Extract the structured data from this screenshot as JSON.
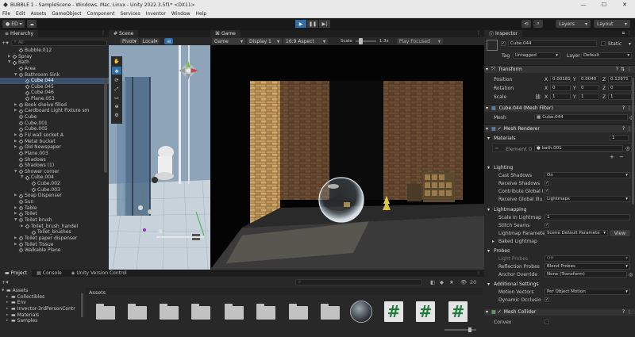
{
  "window": {
    "title": "BUBBLE 1 - SampleScene - Windows, Mac, Linux - Unity 2022.3.5f1* <DX11>",
    "controls": [
      "—",
      "☐",
      "✕"
    ]
  },
  "menu": [
    "File",
    "Edit",
    "Assets",
    "GameObject",
    "Component",
    "Services",
    "Inventor",
    "Window",
    "Help"
  ],
  "toolbar": {
    "account": "ED",
    "layers": "Layers",
    "layout": "Layout"
  },
  "hierarchy": {
    "tab": "Hierarchy",
    "search_placeholder": "All",
    "items": [
      {
        "label": "Bubble.012",
        "indent": 2,
        "arrow": false
      },
      {
        "label": "Spray",
        "indent": 1,
        "arrow": true
      },
      {
        "label": "Bath",
        "indent": 1,
        "arrow": true,
        "open": true
      },
      {
        "label": "Area",
        "indent": 2,
        "arrow": false
      },
      {
        "label": "Bathroom Sink",
        "indent": 2,
        "arrow": true,
        "open": true
      },
      {
        "label": "Cube.044",
        "indent": 3,
        "arrow": false,
        "selected": true
      },
      {
        "label": "Cube.045",
        "indent": 3,
        "arrow": false
      },
      {
        "label": "Cube.046",
        "indent": 3,
        "arrow": false
      },
      {
        "label": "Plane.053",
        "indent": 3,
        "arrow": false
      },
      {
        "label": "Book shelve filled",
        "indent": 2,
        "arrow": true
      },
      {
        "label": "Cardboard Light Fixture sm",
        "indent": 2,
        "arrow": true
      },
      {
        "label": "Cube",
        "indent": 2,
        "arrow": false
      },
      {
        "label": "Cube.001",
        "indent": 2,
        "arrow": false
      },
      {
        "label": "Cube.005",
        "indent": 2,
        "arrow": false
      },
      {
        "label": "FU wall socket A",
        "indent": 2,
        "arrow": true
      },
      {
        "label": "Metal bucket",
        "indent": 2,
        "arrow": true
      },
      {
        "label": "Old Newspaper",
        "indent": 2,
        "arrow": true
      },
      {
        "label": "Plane.003",
        "indent": 2,
        "arrow": false
      },
      {
        "label": "Shadows",
        "indent": 2,
        "arrow": false
      },
      {
        "label": "Shadows (1)",
        "indent": 2,
        "arrow": false
      },
      {
        "label": "Shower corner",
        "indent": 2,
        "arrow": true,
        "open": true
      },
      {
        "label": "Cube.004",
        "indent": 3,
        "arrow": true,
        "open": true
      },
      {
        "label": "Cube.002",
        "indent": 4,
        "arrow": false
      },
      {
        "label": "Cube.003",
        "indent": 4,
        "arrow": false
      },
      {
        "label": "Soap Dispenser",
        "indent": 2,
        "arrow": true
      },
      {
        "label": "Sun",
        "indent": 2,
        "arrow": false
      },
      {
        "label": "Table",
        "indent": 2,
        "arrow": true
      },
      {
        "label": "Toilet",
        "indent": 2,
        "arrow": true
      },
      {
        "label": "Toilet brush",
        "indent": 2,
        "arrow": true,
        "open": true
      },
      {
        "label": "Toilet_brush_handel",
        "indent": 3,
        "arrow": true
      },
      {
        "label": "Toilet_brushes",
        "indent": 4,
        "arrow": false
      },
      {
        "label": "Toilet paper dispenser",
        "indent": 2,
        "arrow": true
      },
      {
        "label": "Toilet Tissue",
        "indent": 2,
        "arrow": true
      },
      {
        "label": "Walkable Plane",
        "indent": 2,
        "arrow": false
      }
    ]
  },
  "scene": {
    "tab": "Scene",
    "pivot": "Pivot",
    "space": "Local"
  },
  "game": {
    "tab": "Game",
    "mode": "Game",
    "display": "Display 1",
    "aspect": "16:9 Aspect",
    "scale_label": "Scale",
    "scale_value": "1.3x",
    "play_focused": "Play Focused"
  },
  "inspector": {
    "tab": "Inspector",
    "object_name": "Cube.044",
    "static_label": "Static",
    "tag_label": "Tag",
    "tag_value": "Untagged",
    "layer_label": "Layer",
    "layer_value": "Default",
    "transform": {
      "title": "Transform",
      "position_label": "Position",
      "rotation_label": "Rotation",
      "scale_label": "Scale",
      "position": {
        "x": "0.00181",
        "y": "0.0040",
        "z": "0.12971"
      },
      "rotation": {
        "x": "0",
        "y": "0",
        "z": "0"
      },
      "scale": {
        "x": "1",
        "y": "1",
        "z": "1"
      }
    },
    "mesh_filter": {
      "title": "Cube.044 (Mesh Filter)",
      "mesh_label": "Mesh",
      "mesh_value": "Cube.044"
    },
    "mesh_renderer": {
      "title": "Mesh Renderer",
      "materials_label": "Materials",
      "materials_count": "1",
      "element_label": "Element 0",
      "element_value": "bath.001",
      "lighting_label": "Lighting",
      "cast_shadows_label": "Cast Shadows",
      "cast_shadows_value": "On",
      "receive_shadows_label": "Receive Shadows",
      "contribute_gi_label": "Contribute Global I",
      "receive_gi_label": "Receive Global Illu",
      "receive_gi_value": "Lightmaps",
      "lightmapping_label": "Lightmapping",
      "scale_lightmap_label": "Scale In Lightmap",
      "scale_lightmap_value": "1",
      "stitch_seams_label": "Stitch Seams",
      "lightmap_params_label": "Lightmap Paramete",
      "lightmap_params_value": "Scene Default Paramete",
      "view_label": "View",
      "baked_lightmap_label": "Baked Lightmap",
      "probes_label": "Probes",
      "light_probes_label": "Light Probes",
      "light_probes_value": "Off",
      "reflection_probes_label": "Reflection Probes",
      "reflection_probes_value": "Blend Probes",
      "anchor_override_label": "Anchor Override",
      "anchor_override_value": "None (Transform)",
      "additional_label": "Additional Settings",
      "motion_vectors_label": "Motion Vectors",
      "motion_vectors_value": "Per Object Motion",
      "dynamic_occlusion_label": "Dynamic Occlusio"
    },
    "mesh_collider": {
      "title": "Mesh Collider",
      "convex_label": "Convex"
    }
  },
  "project": {
    "tabs": [
      "Project",
      "Console",
      "Unity Version Control"
    ],
    "tree_root": "Assets",
    "tree_items": [
      "Collectibles",
      "Env",
      "Invector-3rdPersonContr",
      "Materials",
      "Samples"
    ],
    "breadcrumb": "Assets",
    "count_badge": "20"
  },
  "colors": {
    "accent_blue": "#2f6ea6",
    "selection": "#3c4f6b",
    "panel": "#282828",
    "script_green": "#207a3c"
  }
}
